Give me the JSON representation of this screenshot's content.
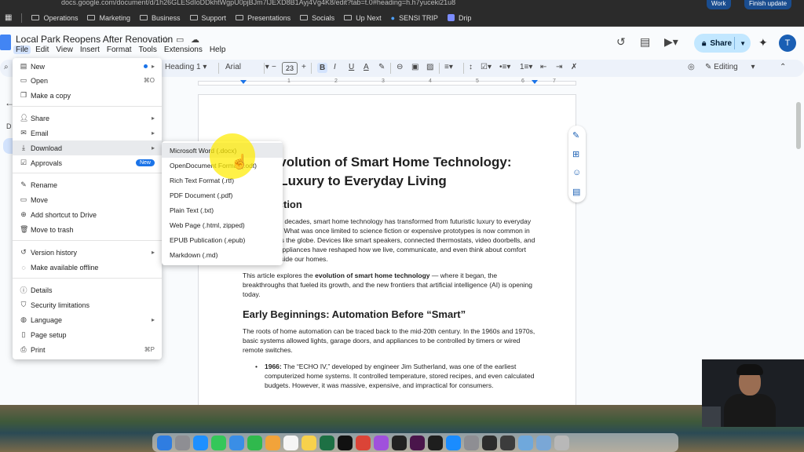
{
  "browser": {
    "url": "docs.google.com/document/d/1h26GLESdIoDDkhtWgpU0pjBJm7lJEXD8B1Ayj4Vg4K8/edit?tab=t.0#heading=h.h7yuceki21u8",
    "profile_label": "Work",
    "update_label": "Finish update"
  },
  "bookmarks": [
    "Operations",
    "Marketing",
    "Business",
    "Support",
    "Presentations",
    "Socials",
    "Up Next",
    "SENSI TRIP",
    "Drip"
  ],
  "doc": {
    "title": "Local Park Reopens After Renovation",
    "menus": [
      "File",
      "Edit",
      "View",
      "Insert",
      "Format",
      "Tools",
      "Extensions",
      "Help"
    ],
    "share_label": "Share",
    "avatar_letter": "T"
  },
  "toolbar": {
    "style": "Heading 1",
    "font": "Arial",
    "font_size": "23",
    "mode": "Editing"
  },
  "ruler_numbers": [
    "1",
    "2",
    "3",
    "4",
    "5",
    "6",
    "7"
  ],
  "file_menu": {
    "new": "New",
    "open": "Open",
    "open_shortcut": "⌘O",
    "make_copy": "Make a copy",
    "share": "Share",
    "email": "Email",
    "download": "Download",
    "approvals": "Approvals",
    "approvals_badge": "New",
    "rename": "Rename",
    "move": "Move",
    "add_shortcut": "Add shortcut to Drive",
    "move_trash": "Move to trash",
    "version_history": "Version history",
    "make_offline": "Make available offline",
    "details": "Details",
    "security": "Security limitations",
    "language": "Language",
    "page_setup": "Page setup",
    "print": "Print",
    "print_shortcut": "⌘P"
  },
  "download_menu": [
    "Microsoft Word (.docx)",
    "OpenDocument Format (.odt)",
    "Rich Text Format (.rtf)",
    "PDF Document (.pdf)",
    "Plain Text (.txt)",
    "Web Page (.html, zipped)",
    "EPUB Publication (.epub)",
    "Markdown (.md)"
  ],
  "document": {
    "h1": "The Evolution of Smart Home Technology: From Luxury to Everyday Living",
    "h2_intro": "Introduction",
    "p1": "Over the past decades, smart home technology has transformed from futuristic luxury to everyday convenience. What was once limited to science fiction or expensive prototypes is now common in homes across the globe. Devices like smart speakers, connected thermostats, video doorbells, and AI-powered appliances have reshaped how we live, communicate, and even think about comfort and safety inside our homes.",
    "p2_a": "This article explores the ",
    "p2_bold": "evolution of smart home technology",
    "p2_b": " — where it began, the breakthroughs that fueled its growth, and the new frontiers that artificial intelligence (AI) is opening today.",
    "h2_early": "Early Beginnings: Automation Before “Smart”",
    "p3": "The roots of home automation can be traced back to the mid-20th century. In the 1960s and 1970s, basic systems allowed lights, garage doors, and appliances to be controlled by timers or wired remote switches.",
    "li1_bold": "1966:",
    "li1": " The “ECHO IV,” developed by engineer Jim Sutherland, was one of the earliest computerized home systems. It controlled temperature, stored recipes, and even calculated budgets. However, it was massive, expensive, and impractical for consumers."
  },
  "dock_apps": [
    {
      "name": "finder",
      "color": "#2f7de1"
    },
    {
      "name": "launchpad",
      "color": "#8e8e93"
    },
    {
      "name": "safari",
      "color": "#1e90ff"
    },
    {
      "name": "messages",
      "color": "#34c759"
    },
    {
      "name": "mail",
      "color": "#3a8ee6"
    },
    {
      "name": "facetime",
      "color": "#30b94d"
    },
    {
      "name": "photos",
      "color": "#f2a33a"
    },
    {
      "name": "calendar",
      "color": "#f5f5f5"
    },
    {
      "name": "notes",
      "color": "#f7d14c"
    },
    {
      "name": "excel",
      "color": "#1d7044"
    },
    {
      "name": "tv",
      "color": "#111111"
    },
    {
      "name": "chrome",
      "color": "#db4437"
    },
    {
      "name": "podcasts",
      "color": "#a050dc"
    },
    {
      "name": "capcut",
      "color": "#222222"
    },
    {
      "name": "slack",
      "color": "#4a154b"
    },
    {
      "name": "figma",
      "color": "#1e1e1e"
    },
    {
      "name": "appstore",
      "color": "#1a8cff"
    },
    {
      "name": "settings",
      "color": "#8e8e93"
    },
    {
      "name": "obs",
      "color": "#2c2c2c"
    },
    {
      "name": "quicktime",
      "color": "#3c3c3c"
    },
    {
      "name": "preview",
      "color": "#6fa8dc"
    },
    {
      "name": "downloads",
      "color": "#7aa7d6"
    },
    {
      "name": "trash",
      "color": "#b8b8b8"
    }
  ]
}
